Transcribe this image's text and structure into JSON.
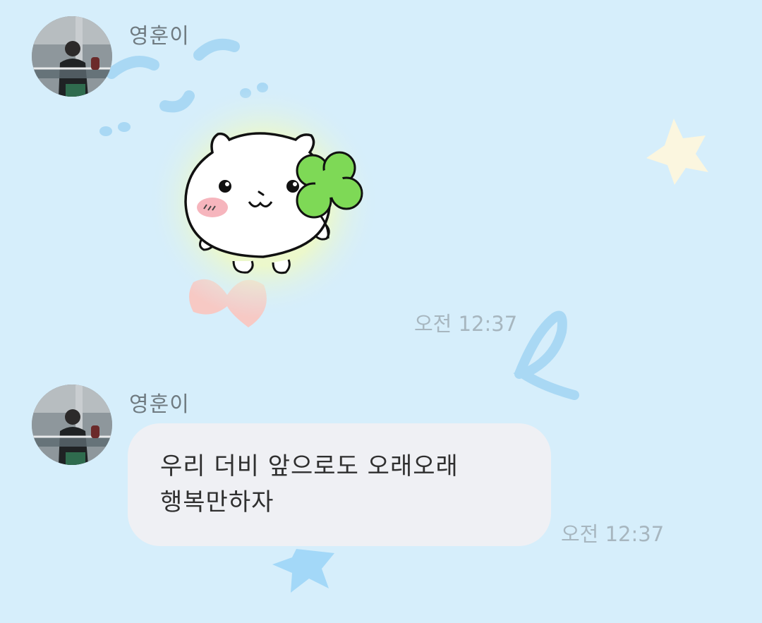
{
  "chat": {
    "colors": {
      "background": "#d6eefb",
      "bubble": "#eff0f4",
      "name_text": "#6f7a80",
      "time_text": "#a7b6bf",
      "message_text": "#2f2f2f"
    },
    "messages": [
      {
        "sender": "영훈이",
        "type": "sticker",
        "sticker_icon": "white-hamster-with-clover-sticker",
        "time": "오전 12:37"
      },
      {
        "sender": "영훈이",
        "type": "text",
        "lines": [
          "우리 더비 앞으로도 오래오래",
          "행복만하자"
        ],
        "time": "오전 12:37"
      }
    ]
  }
}
